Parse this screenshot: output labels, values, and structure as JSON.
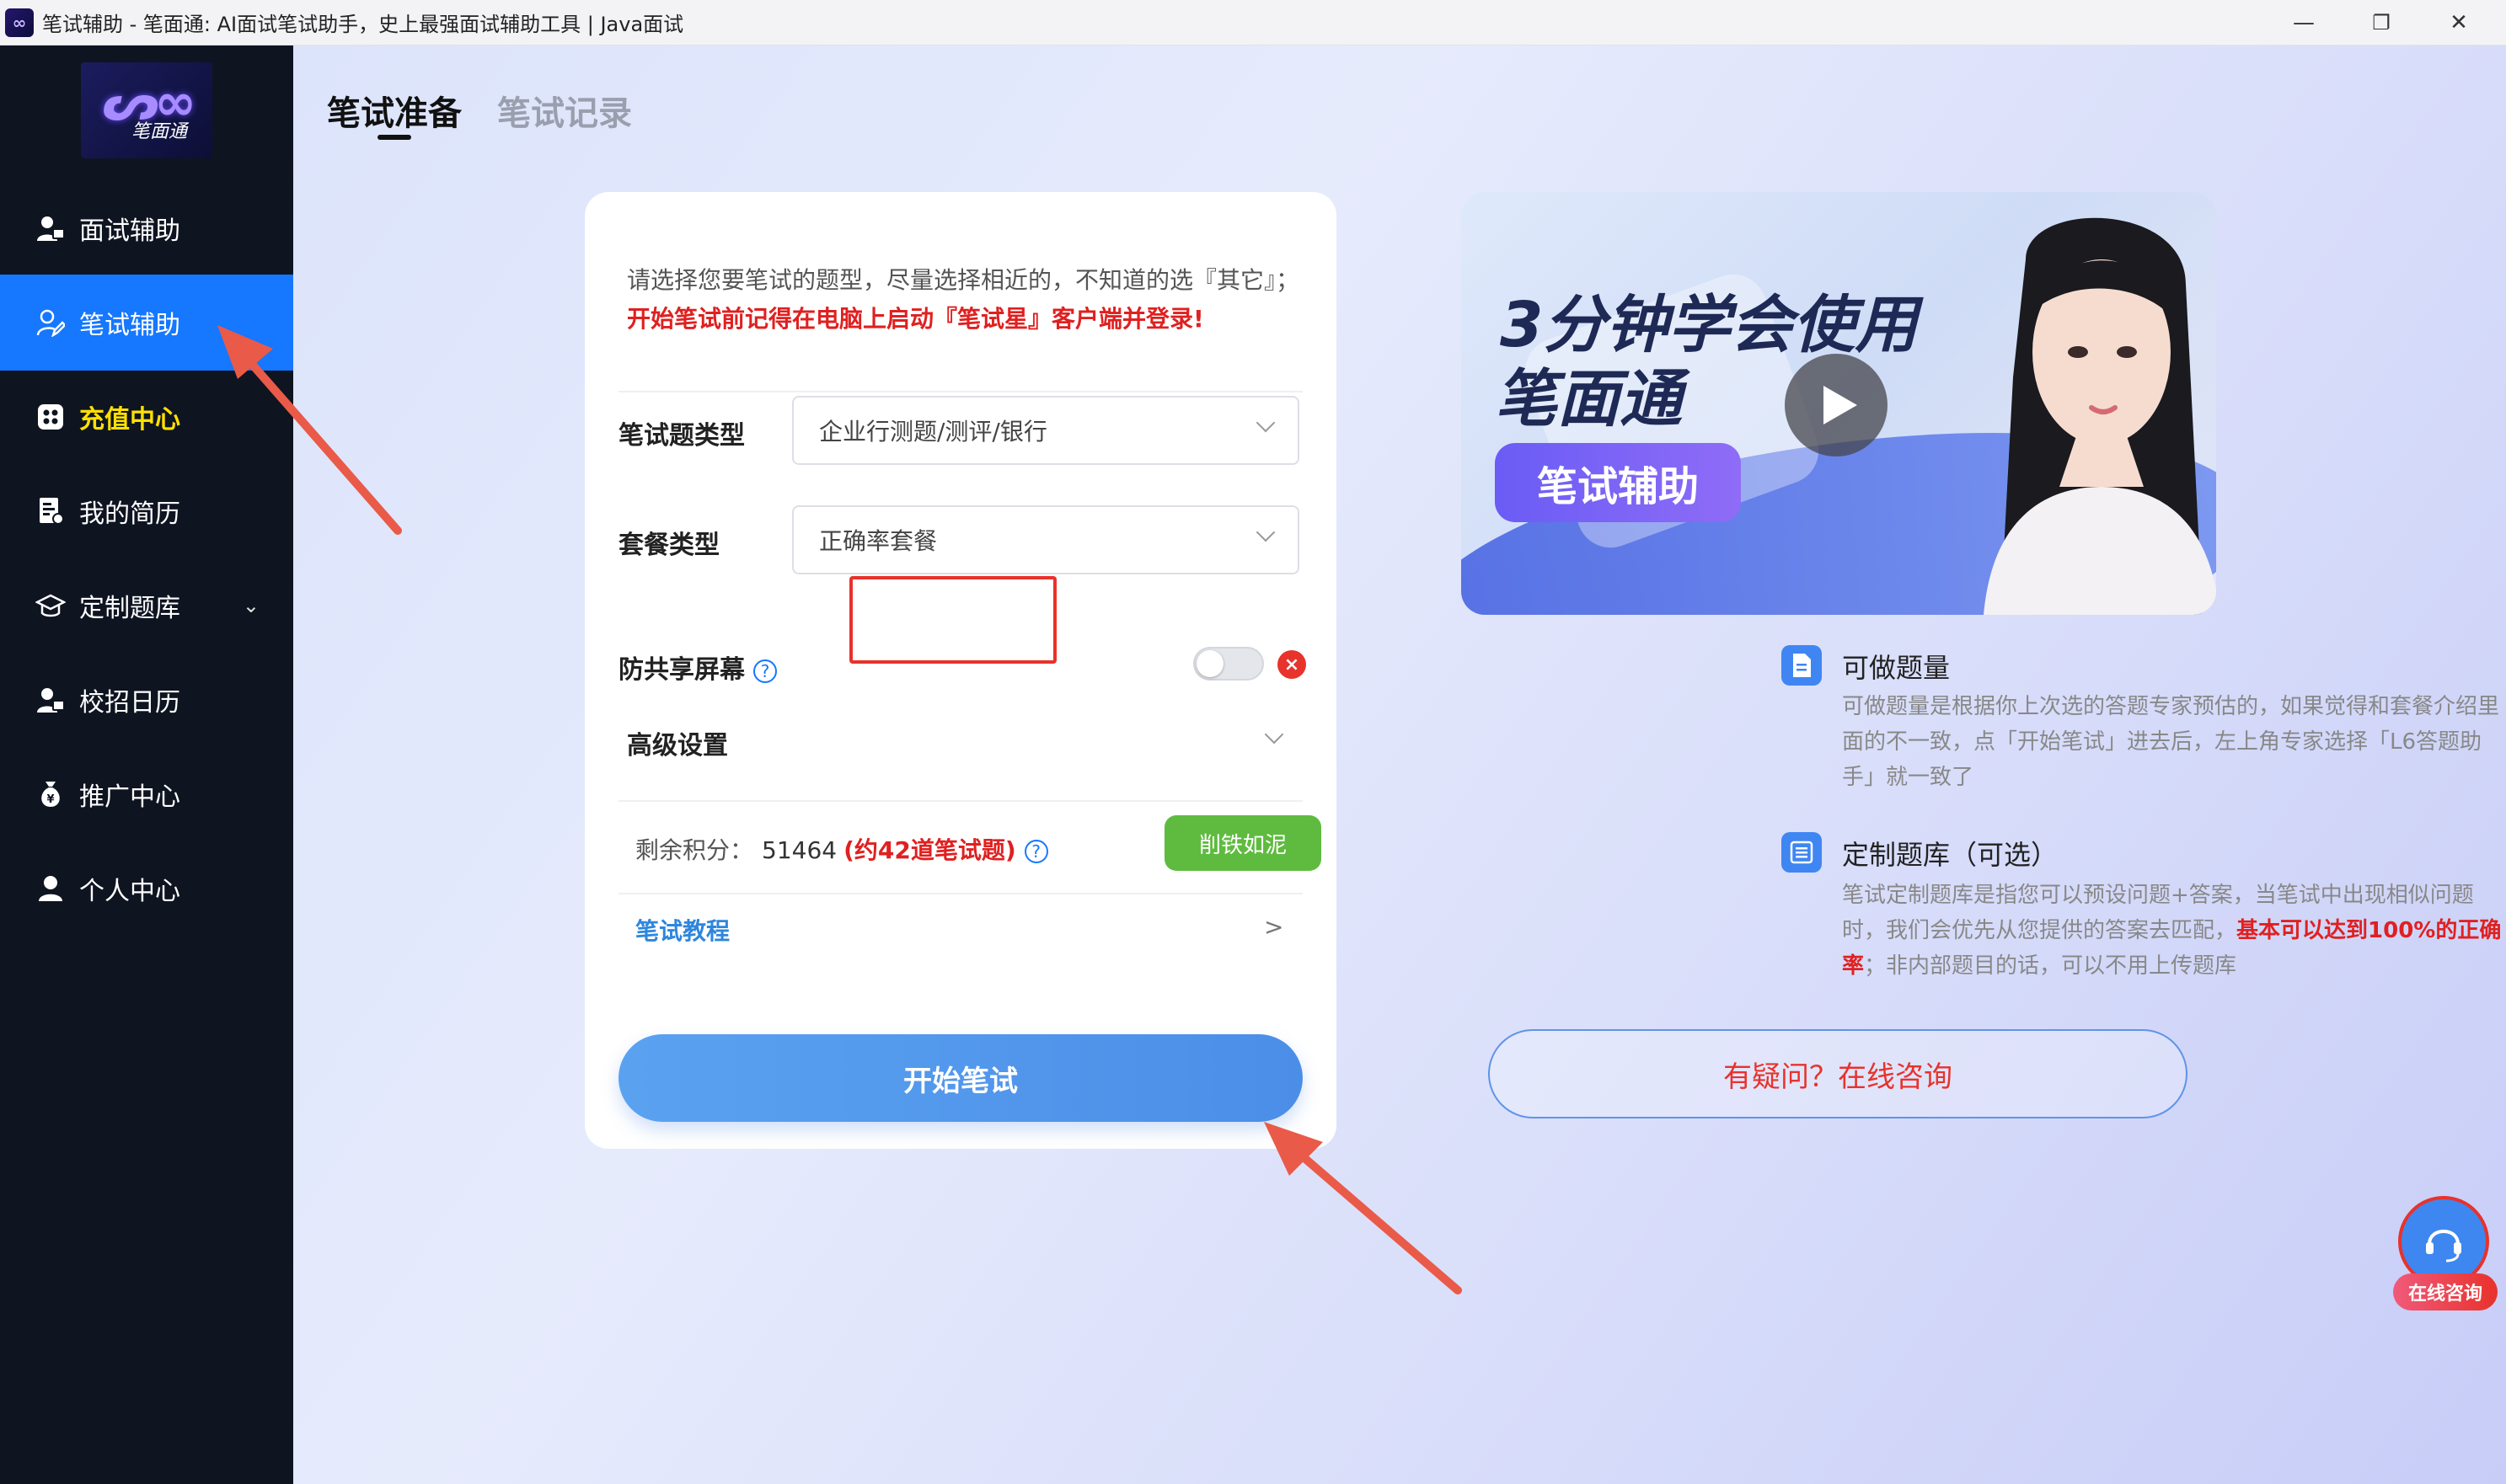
{
  "window": {
    "title": "笔试辅助 - 笔面通: AI面试笔试助手，史上最强面试辅助工具 | Java面试",
    "minimize": "—",
    "restore": "❐",
    "close": "✕"
  },
  "logo": {
    "text": "笔面通"
  },
  "sidebar": {
    "items": [
      {
        "label": "面试辅助",
        "icon": "user-tie-icon"
      },
      {
        "label": "笔试辅助",
        "icon": "user-edit-icon",
        "active": true
      },
      {
        "label": "充值中心",
        "icon": "grid-icon",
        "highlight": true
      },
      {
        "label": "我的简历",
        "icon": "resume-icon"
      },
      {
        "label": "定制题库",
        "icon": "graduation-cap-icon",
        "expandable": true
      },
      {
        "label": "校招日历",
        "icon": "calendar-user-icon"
      },
      {
        "label": "推广中心",
        "icon": "money-bag-icon"
      },
      {
        "label": "个人中心",
        "icon": "person-icon"
      }
    ]
  },
  "tabs": [
    {
      "label": "笔试准备",
      "active": true
    },
    {
      "label": "笔试记录",
      "active": false
    }
  ],
  "form": {
    "notice": "请选择您要笔试的题型，尽量选择相近的，不知道的选『其它』；",
    "notice_warning": "开始笔试前记得在电脑上启动『笔试星』客户端并登录!",
    "exam_type_label": "笔试题类型",
    "exam_type_value": "企业行测题/测评/银行",
    "package_label": "套餐类型",
    "package_value": "正确率套餐",
    "anti_share_label": "防共享屏幕",
    "anti_share_on": false,
    "advanced_label": "高级设置",
    "points_label": "剩余积分：",
    "points_value": "51464",
    "points_hint": "(约42道笔试题)",
    "points_button": "削铁如泥",
    "tutorial_label": "笔试教程",
    "tutorial_arrow": ">",
    "start_button": "开始笔试"
  },
  "banner": {
    "headline_line1": "3分钟学会使用",
    "headline_line2": "笔面通",
    "tag": "笔试辅助"
  },
  "info": {
    "quota_title": "可做题量",
    "quota_text": "可做题量是根据你上次选的答题专家预估的，如果觉得和套餐介绍里面的不一致，点「开始笔试」进去后，左上角专家选择「L6答题助手」就一致了",
    "custom_title": "定制题库（可选）",
    "custom_text": "笔试定制题库是指您可以预设问题+答案，当笔试中出现相似问题时，我们会优先从您提供的答案去匹配，",
    "custom_warning": "基本可以达到100%的正确率",
    "custom_text_end": "；非内部题目的话，可以不用上传题库"
  },
  "consult_button": "有疑问？在线咨询",
  "float_consult": "在线咨询",
  "colors": {
    "accent": "#1677ff",
    "sidebar_bg": "#0f1421",
    "warning": "#e02020",
    "success": "#5fbb3f"
  }
}
